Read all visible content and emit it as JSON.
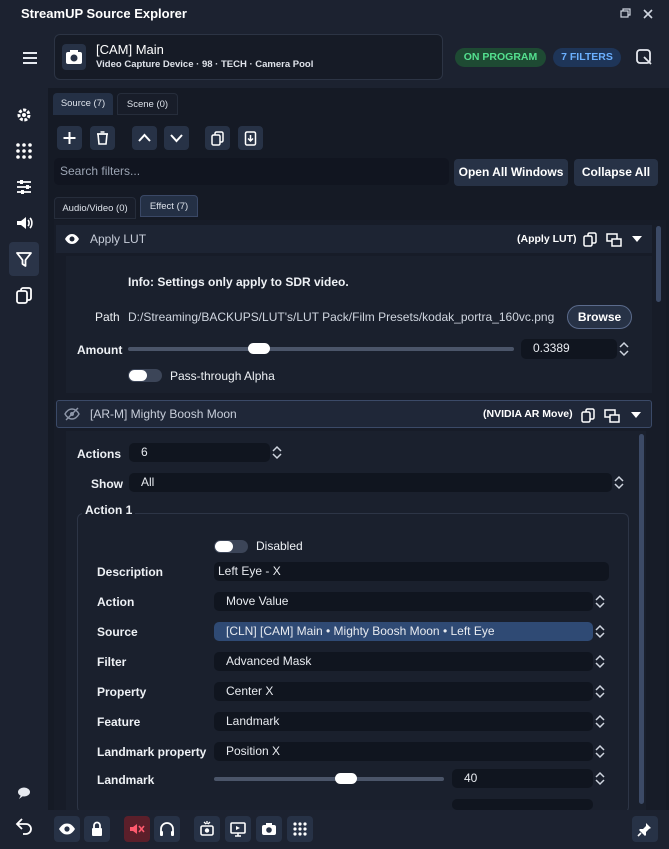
{
  "app": {
    "title": "StreamUP Source Explorer"
  },
  "source": {
    "name": "[CAM] Main",
    "subtitle": "Video Capture Device · 98 · TECH · Camera Pool",
    "status_badge": "ON PROGRAM",
    "filters_badge": "7 FILTERS"
  },
  "tabs": {
    "source": "Source (7)",
    "scene": "Scene (0)"
  },
  "search": {
    "placeholder": "Search filters...",
    "open_all": "Open All Windows",
    "collapse_all": "Collapse All"
  },
  "subtabs": {
    "audio_video": "Audio/Video (0)",
    "effect": "Effect (7)"
  },
  "filter1": {
    "name": "Apply LUT",
    "type": "(Apply LUT)",
    "info": "Info: Settings only apply to SDR video.",
    "path_label": "Path",
    "path_value": "D:/Streaming/BACKUPS/LUT's/LUT Pack/Film Presets/kodak_portra_160vc.png",
    "browse": "Browse",
    "amount_label": "Amount",
    "amount_value": "0.3389",
    "amount_fraction": 0.3389,
    "passthrough_label": "Pass-through Alpha"
  },
  "filter2": {
    "name": "[AR-M] Mighty Boosh Moon",
    "type": "(NVIDIA AR Move)",
    "actions_label": "Actions",
    "actions_value": "6",
    "show_label": "Show",
    "show_value": "All",
    "action_group": "Action 1",
    "disabled_label": "Disabled",
    "rows": [
      {
        "label": "Description",
        "value": "Left Eye - X"
      },
      {
        "label": "Action",
        "value": "Move Value"
      },
      {
        "label": "Source",
        "value": "[CLN] [CAM] Main • Mighty Boosh Moon • Left Eye"
      },
      {
        "label": "Filter",
        "value": "Advanced Mask"
      },
      {
        "label": "Property",
        "value": "Center X"
      },
      {
        "label": "Feature",
        "value": "Landmark"
      },
      {
        "label": "Landmark property",
        "value": "Position X"
      }
    ],
    "landmark_label": "Landmark",
    "landmark_value": "40"
  },
  "icons": {
    "menu": "hamburger-icon",
    "camera": "camera-icon",
    "settings": "gear-icon",
    "grid": "grid-icon",
    "mixer": "sliders-icon",
    "audio": "speaker-icon",
    "filter": "funnel-icon",
    "copy": "copy-icon",
    "chat": "chat-icon",
    "back": "back-arrow-icon"
  },
  "colors": {
    "accent": "#4a90e2",
    "on_program": "#3fd17f",
    "filters": "#5aa8ff",
    "bg": "#14171f"
  }
}
